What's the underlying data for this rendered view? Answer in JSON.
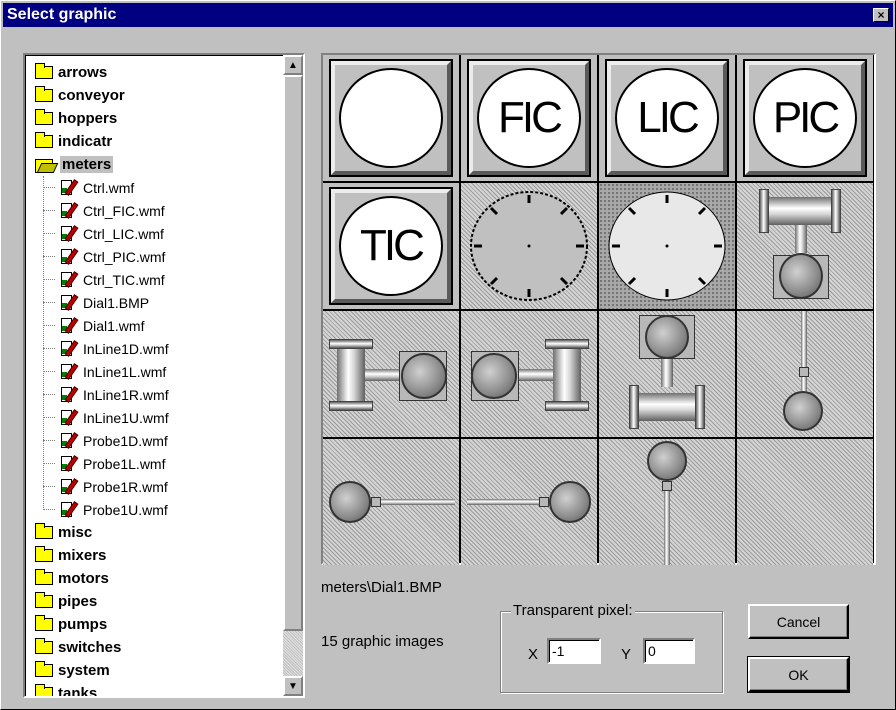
{
  "window": {
    "title": "Select graphic",
    "close_glyph": "×"
  },
  "tree": {
    "folders_before": [
      "arrows",
      "conveyor",
      "hoppers",
      "indicatr"
    ],
    "open_folder": "meters",
    "files": [
      "Ctrl.wmf",
      "Ctrl_FIC.wmf",
      "Ctrl_LIC.wmf",
      "Ctrl_PIC.wmf",
      "Ctrl_TIC.wmf",
      "Dial1.BMP",
      "Dial1.wmf",
      "InLine1D.wmf",
      "InLine1L.wmf",
      "InLine1R.wmf",
      "InLine1U.wmf",
      "Probe1D.wmf",
      "Probe1L.wmf",
      "Probe1R.wmf",
      "Probe1U.wmf"
    ],
    "folders_after": [
      "misc",
      "mixers",
      "motors",
      "pipes",
      "pumps",
      "switches",
      "system",
      "tanks"
    ]
  },
  "grid": {
    "controllers": [
      "",
      "FIC",
      "LIC",
      "PIC",
      "TIC"
    ]
  },
  "selected_path": "meters\\Dial1.BMP",
  "image_count": "15 graphic images",
  "transparent": {
    "label": "Transparent pixel:",
    "x_label": "X",
    "y_label": "Y",
    "x_value": "-1",
    "y_value": "0"
  },
  "buttons": {
    "cancel": "Cancel",
    "ok": "OK"
  },
  "colors": {
    "titlebar": "#000080",
    "folder": "#ffff00",
    "face": "#c0c0c0"
  }
}
